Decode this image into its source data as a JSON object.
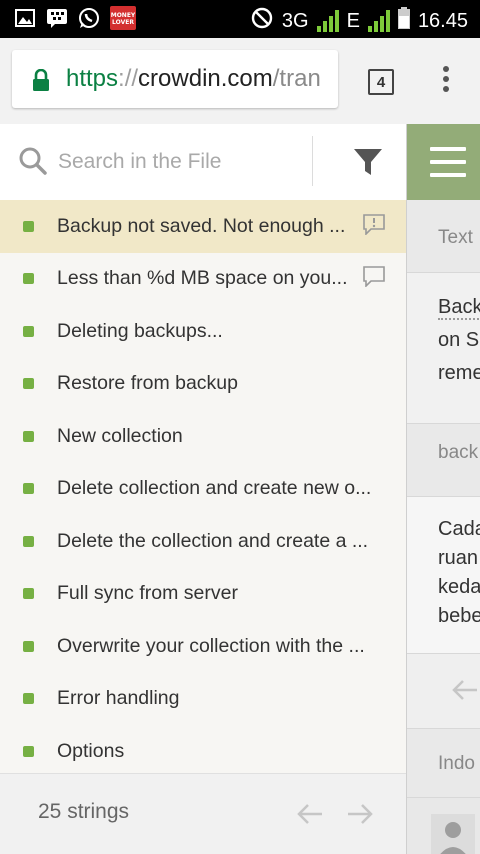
{
  "status_bar": {
    "network": "3G",
    "network2": "E",
    "time": "16.45",
    "icons": [
      "gallery-icon",
      "bbm-icon",
      "whatsapp-icon",
      "money-lover-icon",
      "dnd-icon",
      "signal-icon",
      "battery-icon"
    ],
    "money_lover_label": "MONEY LOVER"
  },
  "browser": {
    "url_scheme": "https",
    "url_sep": "://",
    "url_host": "crowdin.com",
    "url_path": "/tran",
    "tab_count": "4"
  },
  "search": {
    "placeholder": "Search in the File"
  },
  "strings": [
    {
      "label": "Backup not saved. Not enough ...",
      "selected": true,
      "icon": "comment-alert-icon"
    },
    {
      "label": "Less than %d MB space on you...",
      "selected": false,
      "icon": "comment-icon"
    },
    {
      "label": "Deleting backups...",
      "selected": false
    },
    {
      "label": "Restore from backup",
      "selected": false
    },
    {
      "label": "New collection",
      "selected": false
    },
    {
      "label": "Delete collection and create new o...",
      "selected": false
    },
    {
      "label": "Delete the collection and create a ...",
      "selected": false
    },
    {
      "label": "Full sync from server",
      "selected": false
    },
    {
      "label": "Overwrite your collection with the ...",
      "selected": false
    },
    {
      "label": "Error handling",
      "selected": false
    },
    {
      "label": "Options",
      "selected": false
    }
  ],
  "footer": {
    "count": "25 strings"
  },
  "right_panel": {
    "text_label": "Text",
    "source_lines": [
      "Back",
      "on S",
      "reme"
    ],
    "context_label": "back",
    "translation_lines": [
      "Cada",
      "ruan",
      "keda",
      "bebe"
    ],
    "language_label": "Indo"
  },
  "colors": {
    "accent_green": "#76b043",
    "selected_row": "#f1e8c8",
    "header_green": "#93ac78",
    "url_green": "#0b8043"
  }
}
